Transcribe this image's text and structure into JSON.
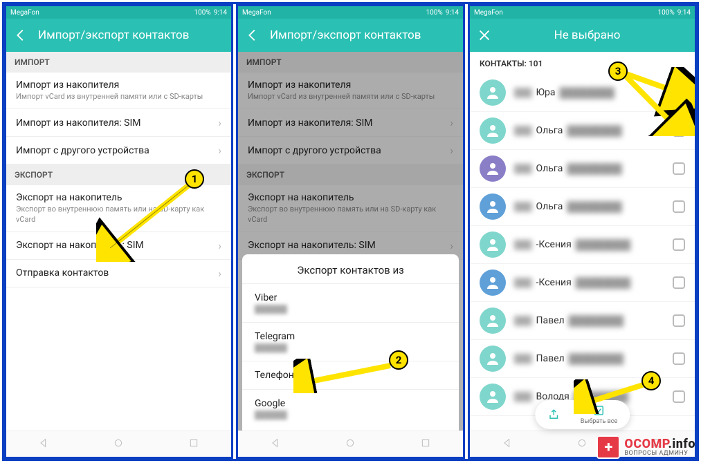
{
  "statusbar": {
    "carrier": "MegaFon",
    "battery": "100%",
    "time": "9:14"
  },
  "screen1": {
    "title": "Импорт/экспорт контактов",
    "section_import": "ИМПОРТ",
    "section_export": "ЭКСПОРТ",
    "import_storage": "Импорт из накопителя",
    "import_storage_sub": "Импорт vCard из внутренней памяти или с SD-карты",
    "import_sim": "Импорт из накопителя: SIM",
    "import_other": "Импорт с другого устройства",
    "export_storage": "Экспорт на накопитель",
    "export_storage_sub": "Экспорт во внутреннюю память или на SD-карту как vCard",
    "export_sim": "Экспорт на накопитель: SIM",
    "send_contacts": "Отправка контактов"
  },
  "screen2": {
    "title": "Импорт/экспорт контактов",
    "sheet_title": "Экспорт контактов из",
    "opt_viber": "Viber",
    "opt_telegram": "Telegram",
    "opt_phone": "Телефон",
    "opt_google": "Google"
  },
  "screen3": {
    "title": "Не выбрано",
    "count_label": "КОНТАКТЫ: 101",
    "contacts": [
      {
        "name": "Юра",
        "avatar": "teal"
      },
      {
        "name": "Ольга",
        "avatar": "teal"
      },
      {
        "name": "Ольга",
        "avatar": "purple"
      },
      {
        "name": "Ольга",
        "avatar": "blue"
      },
      {
        "name": "-Ксения",
        "avatar": "teal"
      },
      {
        "name": "-Ксения",
        "avatar": "blue"
      },
      {
        "name": "Павел",
        "avatar": "teal"
      },
      {
        "name": "Павел",
        "avatar": "teal"
      },
      {
        "name": "Володя",
        "avatar": "teal"
      }
    ],
    "select_all": "Выбрать все"
  },
  "markers": {
    "m1": "1",
    "m2": "2",
    "m3": "3",
    "m4": "4"
  },
  "watermark": {
    "brand": "OCOMP",
    "domain": ".info",
    "sub": "ВОПРОСЫ АДМИНУ",
    "badge": "+"
  }
}
